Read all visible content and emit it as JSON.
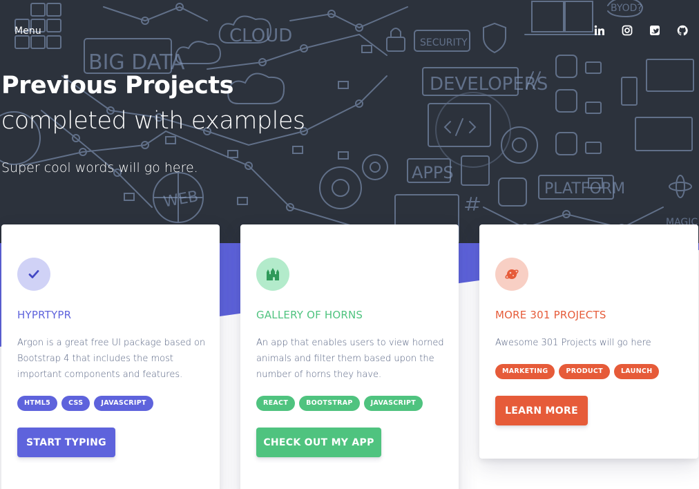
{
  "nav": {
    "menu_label": "Menu",
    "social": [
      {
        "icon": "linkedin-icon"
      },
      {
        "icon": "instagram-icon"
      },
      {
        "icon": "twitter-icon"
      },
      {
        "icon": "github-icon"
      }
    ]
  },
  "hero": {
    "title": "Previous Projects",
    "subtitle": "completed with examples",
    "tagline": "Super cool words will go here.",
    "background_labels": [
      "BIG DATA",
      "CLOUD",
      "SECURITY",
      "DEVELOPERS",
      "APPS",
      "PLATFORM",
      "WEB",
      "BYOD?",
      "MAGIC"
    ]
  },
  "colors": {
    "hero_bg": "#2c323c",
    "accent_purple": "#5e63dc",
    "green": "#4fc37f",
    "orange": "#e65b39"
  },
  "cards": [
    {
      "icon": "check-icon",
      "title": "HYPRTYPR",
      "description": "Argon is a great free UI package based on Bootstrap 4 that includes the most important components and features.",
      "tags": [
        "HTML5",
        "CSS",
        "JAVASCRIPT"
      ],
      "button_label": "START TYPING",
      "color": "#5e63dc",
      "icon_bg": "#d0d2f6"
    },
    {
      "icon": "castle-icon",
      "title": "GALLERY OF HORNS",
      "description": "An app that enables users to view horned animals and filter them based upon the number of horns they have.",
      "tags": [
        "REACT",
        "BOOTSTRAP",
        "JAVASCRIPT"
      ],
      "button_label": "CHECK OUT MY APP",
      "color": "#4fc37f",
      "icon_bg": "#b3ebcb"
    },
    {
      "icon": "planet-icon",
      "title": "MORE 301 PROJECTS",
      "description": "Awesome 301 Projects will go here",
      "tags": [
        "MARKETING",
        "PRODUCT",
        "LAUNCH"
      ],
      "button_label": "LEARN MORE",
      "color": "#e65b39",
      "icon_bg": "#f8cfc4"
    }
  ]
}
